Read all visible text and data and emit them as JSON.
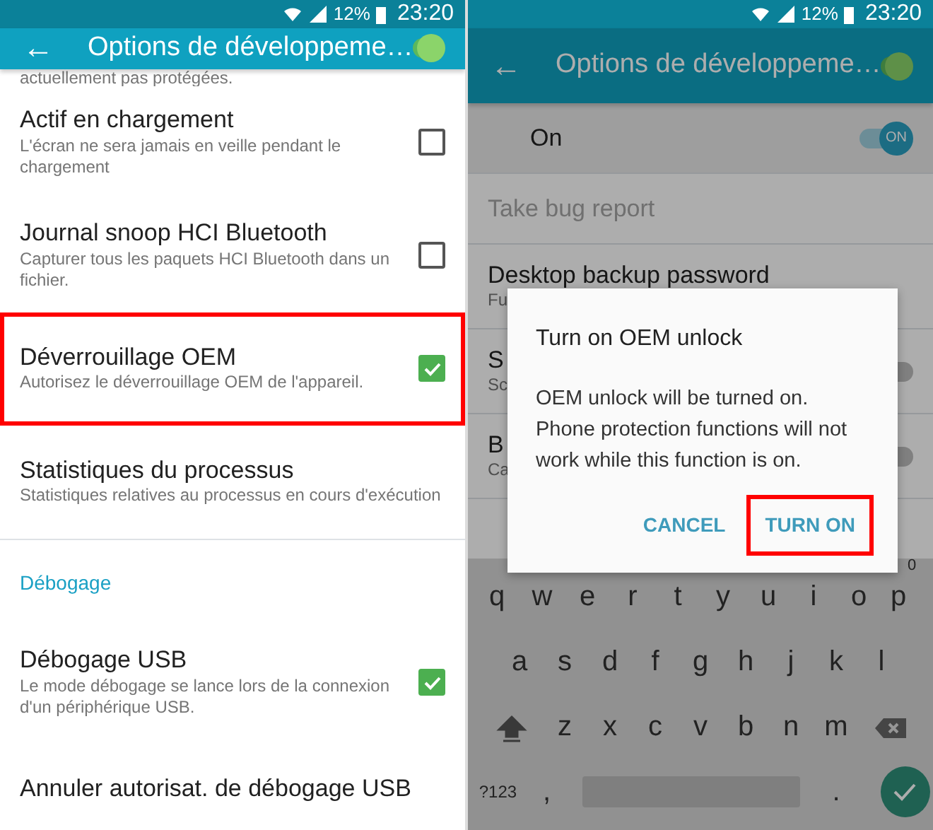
{
  "screens": [
    {
      "status_bar": {
        "battery": "12%",
        "time": "23:20"
      },
      "app_bar": {
        "back": "←",
        "title": "Options de développeme…",
        "switch_on": true
      },
      "list": [
        {
          "kind": "fragment",
          "summary": "actuellement pas protégées."
        },
        {
          "kind": "checkbox",
          "title": "Actif en chargement",
          "summary": "L'écran ne sera jamais en veille pendant le chargement",
          "checked": false,
          "highlighted": false
        },
        {
          "kind": "checkbox",
          "title": "Journal snoop HCI Bluetooth",
          "summary": "Capturer tous les paquets HCI Bluetooth dans un fichier.",
          "checked": false,
          "highlighted": false
        },
        {
          "kind": "checkbox",
          "title": "Déverrouillage OEM",
          "summary": "Autorisez le déverrouillage OEM de l'appareil.",
          "checked": true,
          "highlighted": true
        },
        {
          "kind": "plain",
          "title": "Statistiques du processus",
          "summary": "Statistiques relatives au processus en cours d'exécution"
        },
        {
          "kind": "header",
          "title": "Débogage"
        },
        {
          "kind": "checkbox",
          "title": "Débogage USB",
          "summary": "Le mode débogage se lance lors de la connexion d'un périphérique USB.",
          "checked": true,
          "highlighted": false
        },
        {
          "kind": "plain",
          "title": "Annuler autorisat. de débogage USB"
        }
      ]
    },
    {
      "dimmed": true,
      "status_bar": {
        "battery": "12%",
        "time": "23:20"
      },
      "app_bar": {
        "back": "←",
        "title": "Options de développeme…",
        "switch_on": true
      },
      "list": [
        {
          "kind": "master",
          "title": "On",
          "on": true,
          "badge": "ON"
        },
        {
          "kind": "plain",
          "title": "Take bug report",
          "disabled": true
        },
        {
          "kind": "plain",
          "title": "Desktop backup password",
          "summary": "Fu",
          "disabled": false
        },
        {
          "kind": "switch",
          "title": "S",
          "summary": "Sc",
          "on": false,
          "disabled": false
        },
        {
          "kind": "switch",
          "title": "B",
          "summary": "Ca",
          "on": false,
          "disabled": false
        }
      ],
      "dialog": {
        "title": "Turn on OEM unlock",
        "message": "OEM unlock will be turned on. Phone protection functions will not work while this function is on.",
        "buttons": [
          {
            "label": "CANCEL",
            "highlighted": false
          },
          {
            "label": "TURN ON",
            "highlighted": true
          }
        ]
      },
      "keyboard": {
        "rows": [
          {
            "keys": [
              {
                "kind": "letter",
                "label": "q"
              },
              {
                "kind": "letter",
                "label": "w"
              },
              {
                "kind": "letter",
                "label": "e"
              },
              {
                "kind": "letter",
                "label": "r"
              },
              {
                "kind": "letter",
                "label": "t"
              },
              {
                "kind": "letter",
                "label": "y"
              },
              {
                "kind": "letter",
                "label": "u"
              },
              {
                "kind": "letter",
                "label": "i"
              },
              {
                "kind": "letter",
                "label": "o"
              },
              {
                "kind": "letter",
                "label": "p",
                "hint": "0"
              }
            ]
          },
          {
            "keys": [
              {
                "kind": "letter",
                "label": "a"
              },
              {
                "kind": "letter",
                "label": "s"
              },
              {
                "kind": "letter",
                "label": "d"
              },
              {
                "kind": "letter",
                "label": "f"
              },
              {
                "kind": "letter",
                "label": "g"
              },
              {
                "kind": "letter",
                "label": "h"
              },
              {
                "kind": "letter",
                "label": "j"
              },
              {
                "kind": "letter",
                "label": "k"
              },
              {
                "kind": "letter",
                "label": "l"
              }
            ]
          },
          {
            "keys": [
              {
                "kind": "shift"
              },
              {
                "kind": "letter",
                "label": "z"
              },
              {
                "kind": "letter",
                "label": "x"
              },
              {
                "kind": "letter",
                "label": "c"
              },
              {
                "kind": "letter",
                "label": "v"
              },
              {
                "kind": "letter",
                "label": "b"
              },
              {
                "kind": "letter",
                "label": "n"
              },
              {
                "kind": "letter",
                "label": "m"
              },
              {
                "kind": "backspace"
              }
            ]
          },
          {
            "keys": [
              {
                "kind": "symbols",
                "label": "?123"
              },
              {
                "kind": "letter",
                "label": ","
              },
              {
                "kind": "space"
              },
              {
                "kind": "letter",
                "label": "."
              },
              {
                "kind": "enter"
              }
            ]
          }
        ]
      }
    }
  ]
}
